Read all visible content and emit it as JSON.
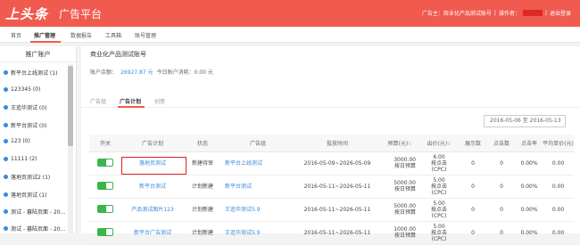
{
  "header": {
    "logo": "上头条",
    "platform": "广告平台",
    "advertiser_label": "广告主：商业化产品测试账号",
    "operator_label": "操作者：",
    "logout": "退出登录",
    "bg_color": "#f05a4f"
  },
  "nav": {
    "tabs": [
      "首页",
      "推广管理",
      "数据报告",
      "工具箱",
      "账号管理"
    ],
    "active": "推广管理"
  },
  "sidebar": {
    "title": "推广账户",
    "items": [
      "新平台上线测试 (1)",
      "123345 (0)",
      "王追华测试 (0)",
      "新平台测试 (0)",
      "123 (0)",
      "11111 (2)",
      "落地页测试2 (1)",
      "落地页测试 (1)",
      "测试 - 暮陆页面 - 20...",
      "测试 - 暮陆页面 - 20..."
    ]
  },
  "account": {
    "name": "商业化产品测试账号",
    "balance_label": "账户余额：",
    "balance_value": "26927.87 元",
    "today_label": "今日账户消耗：0.00 元"
  },
  "content_tabs": [
    "广告组",
    "广告计划",
    "创意"
  ],
  "content_tab_active": "广告计划",
  "date_range": "2016-05-06 至 2016-05-13",
  "table": {
    "headers": [
      "开关",
      "广告计划",
      "状态",
      "广告组",
      "投放时间",
      "预算(元)",
      "出价(元)",
      "展示数",
      "点击数",
      "点击率",
      "平均单价(元)"
    ],
    "rows": [
      {
        "plan": "落地页测试",
        "status": "新建待审",
        "group": "新平台上线测试",
        "time": "2016-05-09~2026-05-09",
        "budget": [
          "3000.00",
          "按日预算"
        ],
        "bid": [
          "6.00",
          "按点击",
          "(CPC)"
        ],
        "impressions": "0",
        "clicks": "0",
        "ctr": "0.00%",
        "avg": "0.00"
      },
      {
        "plan": "新平台测试",
        "status": "计划新建",
        "group": "新平台测试",
        "time": "2016-05-11~2026-05-11",
        "budget": [
          "5000.00",
          "按日预算"
        ],
        "bid": [
          "5.00",
          "按点击",
          "(CPC)"
        ],
        "impressions": "0",
        "clicks": "0",
        "ctr": "0.00%",
        "avg": "0.00"
      },
      {
        "plan": "产品测试图片123",
        "status": "计划新建",
        "group": "王追华测试5.9",
        "time": "2016-05-11~2026-05-11",
        "budget": [
          "5000.00",
          "按日预算"
        ],
        "bid": [
          "5.00",
          "按点击",
          "(CPC)"
        ],
        "impressions": "0",
        "clicks": "0",
        "ctr": "0.00%",
        "avg": "0.00"
      },
      {
        "plan": "新平台广告测试",
        "status": "计划新建",
        "group": "王追华测试5.9",
        "time": "2016-05-11~2026-05-11",
        "budget": [
          "1000.00",
          "按日预算"
        ],
        "bid": [
          "5.00",
          "按点击",
          "(CPC)"
        ],
        "impressions": "0",
        "clicks": "0",
        "ctr": "0.00%",
        "avg": "0.00"
      }
    ]
  },
  "colors": {
    "accent": "#f05a4f",
    "link": "#3a8ad8",
    "toggle_on": "#3bb54a",
    "highlight": "#e02020"
  }
}
